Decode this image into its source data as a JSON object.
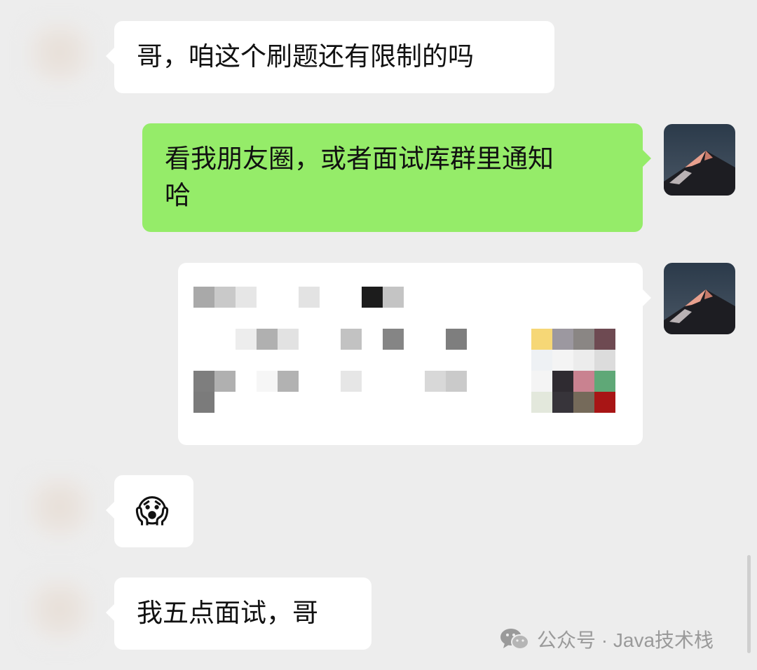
{
  "messages": [
    {
      "side": "left",
      "text": "哥，咱这个刷题还有限制的吗"
    },
    {
      "side": "right",
      "text_line1": "看我朋友圈，或者面试库群里通知",
      "text_line2": "哈"
    },
    {
      "side": "right",
      "type": "image-mosaic"
    },
    {
      "side": "left",
      "emoji": "😱"
    },
    {
      "side": "left",
      "text": "我五点面试，哥"
    }
  ],
  "watermark": {
    "text": "公众号 · Java技术栈",
    "icon": "wechat-icon"
  },
  "colors": {
    "background": "#ededed",
    "incoming_bubble": "#ffffff",
    "outgoing_bubble": "#95ec69"
  }
}
